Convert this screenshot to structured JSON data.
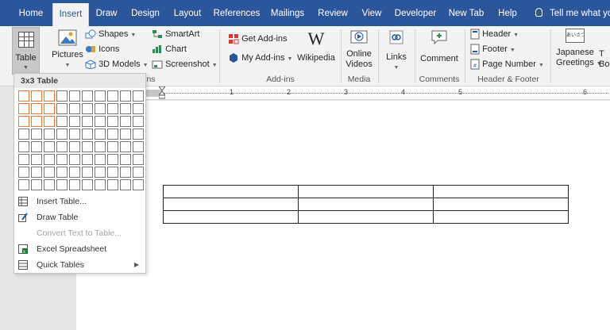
{
  "tabs": [
    {
      "label": "Home",
      "active": false
    },
    {
      "label": "Insert",
      "active": true
    },
    {
      "label": "Draw",
      "active": false
    },
    {
      "label": "Design",
      "active": false
    },
    {
      "label": "Layout",
      "active": false
    },
    {
      "label": "References",
      "active": false
    },
    {
      "label": "Mailings",
      "active": false
    },
    {
      "label": "Review",
      "active": false
    },
    {
      "label": "View",
      "active": false
    },
    {
      "label": "Developer",
      "active": false
    },
    {
      "label": "New Tab",
      "active": false
    },
    {
      "label": "Help",
      "active": false
    }
  ],
  "tell_me": "Tell me what you",
  "ribbon": {
    "table": "Table",
    "pictures": "Pictures",
    "shapes": "Shapes",
    "icons": "Icons",
    "models3d": "3D Models",
    "smartart": "SmartArt",
    "chart": "Chart",
    "screenshot": "Screenshot",
    "get_addins": "Get Add-ins",
    "my_addins": "My Add-ins",
    "wikipedia": "Wikipedia",
    "online_videos": [
      "Online",
      "Videos"
    ],
    "links": "Links",
    "comment": "Comment",
    "header": "Header",
    "footer": "Footer",
    "page_number": "Page Number",
    "japanese_greetings": [
      "Japanese",
      "Greetings"
    ],
    "tb_partial": [
      "T",
      "Bo"
    ],
    "japanese_icon_text": "あいさつ",
    "groups": {
      "illustrations_partial": "ns",
      "addins": "Add-ins",
      "media": "Media",
      "comments": "Comments",
      "header_footer": "Header & Footer"
    }
  },
  "ruler": {
    "numbers": [
      "1",
      "2",
      "3",
      "4",
      "5",
      "6"
    ]
  },
  "table_dropdown": {
    "title": "3x3 Table",
    "grid_cols": 10,
    "grid_rows": 8,
    "selected_cols": 3,
    "selected_rows": 3,
    "items": [
      {
        "label": "Insert Table...",
        "enabled": true
      },
      {
        "label": "Draw Table",
        "enabled": true
      },
      {
        "label": "Convert Text to Table...",
        "enabled": false
      },
      {
        "label": "Excel Spreadsheet",
        "enabled": true
      },
      {
        "label": "Quick Tables",
        "enabled": true
      }
    ]
  },
  "colors": {
    "tab_bar": "#2b579a",
    "selection": "#e87a3c",
    "ribbon_bg": "#f3f3f3"
  }
}
